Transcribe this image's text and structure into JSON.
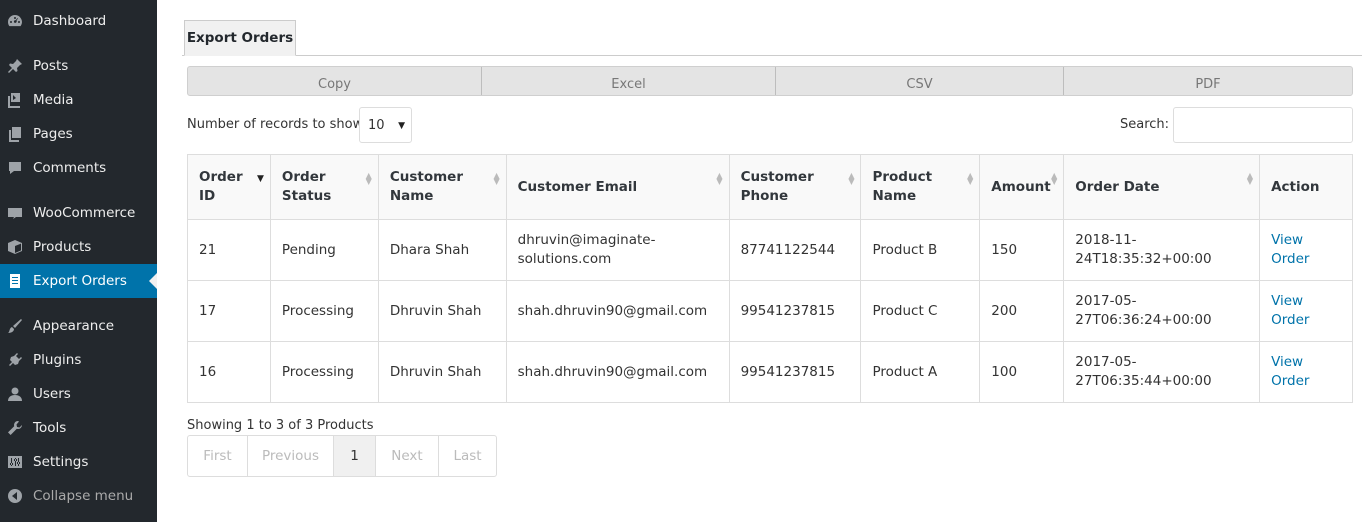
{
  "sidebar": {
    "items": [
      {
        "label": "Dashboard",
        "icon": "dashboard-icon"
      },
      {
        "label": "Posts",
        "icon": "pushpin-icon"
      },
      {
        "label": "Media",
        "icon": "media-icon"
      },
      {
        "label": "Pages",
        "icon": "pages-icon"
      },
      {
        "label": "Comments",
        "icon": "comment-icon"
      },
      {
        "label": "WooCommerce",
        "icon": "woocommerce-icon"
      },
      {
        "label": "Products",
        "icon": "products-box-icon"
      },
      {
        "label": "Export Orders",
        "icon": "spreadsheet-icon",
        "current": true
      },
      {
        "label": "Appearance",
        "icon": "paintbrush-icon"
      },
      {
        "label": "Plugins",
        "icon": "plugin-icon"
      },
      {
        "label": "Users",
        "icon": "users-icon"
      },
      {
        "label": "Tools",
        "icon": "wrench-icon"
      },
      {
        "label": "Settings",
        "icon": "settings-sliders-icon"
      },
      {
        "label": "Collapse menu",
        "icon": "collapse-arrow-icon"
      }
    ]
  },
  "tab": {
    "label": "Export Orders"
  },
  "buttons": [
    "Copy",
    "Excel",
    "CSV",
    "PDF"
  ],
  "length": {
    "label": "Number of records to show:",
    "value": "10"
  },
  "search": {
    "label": "Search:",
    "value": ""
  },
  "table": {
    "headers": [
      "Order\nID",
      "Order\nStatus",
      "Customer\nName",
      "Customer Email",
      "Customer\nPhone",
      "Product\nName",
      "Amount",
      "Order Date",
      "Action"
    ],
    "rows": [
      [
        "21",
        "Pending",
        "Dhara Shah",
        "dhruvin@imaginate-\nsolutions.com",
        "87741122544",
        "Product B",
        "150",
        "2018-11-\n24T18:35:32+00:00",
        "View\nOrder"
      ],
      [
        "17",
        "Processing",
        "Dhruvin Shah",
        "shah.dhruvin90@gmail.com",
        "99541237815",
        "Product C",
        "200",
        "2017-05-\n27T06:36:24+00:00",
        "View\nOrder"
      ],
      [
        "16",
        "Processing",
        "Dhruvin Shah",
        "shah.dhruvin90@gmail.com",
        "99541237815",
        "Product A",
        "100",
        "2017-05-\n27T06:35:44+00:00",
        "View\nOrder"
      ]
    ]
  },
  "info": "Showing 1 to 3 of 3 Products",
  "pagination": [
    "First",
    "Previous",
    "1",
    "Next",
    "Last"
  ],
  "colors": {
    "sidebar_bg": "#23282d",
    "accent": "#0073aa",
    "link": "#0073aa"
  }
}
